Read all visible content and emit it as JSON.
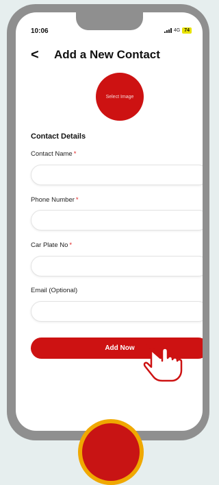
{
  "status_bar": {
    "time": "10:06",
    "network": "4G",
    "battery": "74"
  },
  "header": {
    "back_icon": "chevron-left-icon",
    "back_label": "<",
    "title": "Add a New Contact"
  },
  "avatar_picker": {
    "label": "Select Image"
  },
  "form": {
    "section_title": "Contact Details",
    "required_marker": "*",
    "fields": [
      {
        "label": "Contact Name",
        "required": true,
        "value": "",
        "placeholder": ""
      },
      {
        "label": "Phone Number",
        "required": true,
        "value": "",
        "placeholder": ""
      },
      {
        "label": "Car Plate No",
        "required": true,
        "value": "",
        "placeholder": ""
      },
      {
        "label": "Email (Optional)",
        "required": false,
        "value": "",
        "placeholder": ""
      }
    ],
    "submit_label": "Add Now"
  },
  "colors": {
    "accent": "#cd1212",
    "phone_frame": "#8f8f8f",
    "battery": "#e8e200",
    "home_ring": "#f0a800"
  },
  "icons": {
    "pointer": "hand-pointer-icon",
    "signal": "signal-icon",
    "home": "home-button"
  }
}
